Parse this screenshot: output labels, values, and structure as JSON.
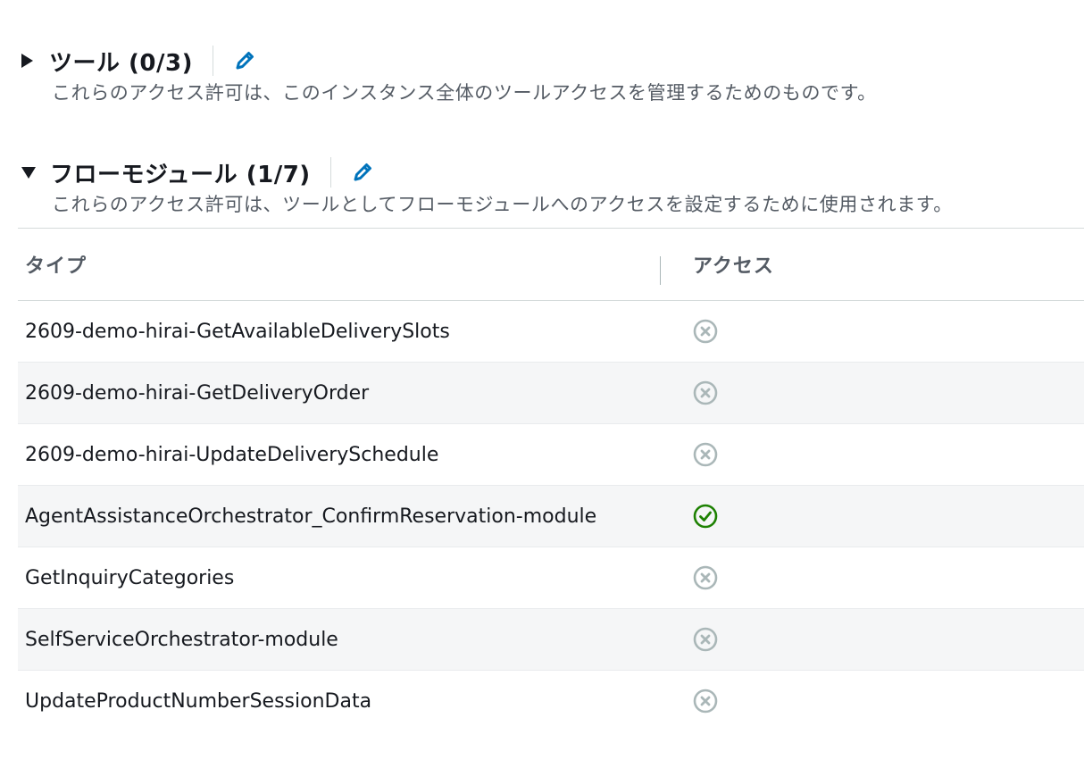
{
  "sections": {
    "tools": {
      "title": "ツール (0/3)",
      "description": "これらのアクセス許可は、このインスタンス全体のツールアクセスを管理するためのものです。",
      "expanded": false
    },
    "flow_modules": {
      "title": "フローモジュール (1/7)",
      "description": "これらのアクセス許可は、ツールとしてフローモジュールへのアクセスを設定するために使用されます。",
      "expanded": true
    }
  },
  "table": {
    "headers": {
      "type": "タイプ",
      "access": "アクセス"
    },
    "rows": [
      {
        "name": "2609-demo-hirai-GetAvailableDeliverySlots",
        "access": "denied"
      },
      {
        "name": "2609-demo-hirai-GetDeliveryOrder",
        "access": "denied"
      },
      {
        "name": "2609-demo-hirai-UpdateDeliverySchedule",
        "access": "denied"
      },
      {
        "name": "AgentAssistanceOrchestrator_ConfirmReservation-module",
        "access": "granted"
      },
      {
        "name": "GetInquiryCategories",
        "access": "denied"
      },
      {
        "name": "SelfServiceOrchestrator-module",
        "access": "denied"
      },
      {
        "name": "UpdateProductNumberSessionData",
        "access": "denied"
      }
    ]
  },
  "icons": {
    "edit": "pencil-icon",
    "denied": "x-circle-icon",
    "granted": "check-circle-icon"
  },
  "colors": {
    "accent": "#0073bb",
    "granted": "#1d8102",
    "denied": "#aab7b8"
  }
}
